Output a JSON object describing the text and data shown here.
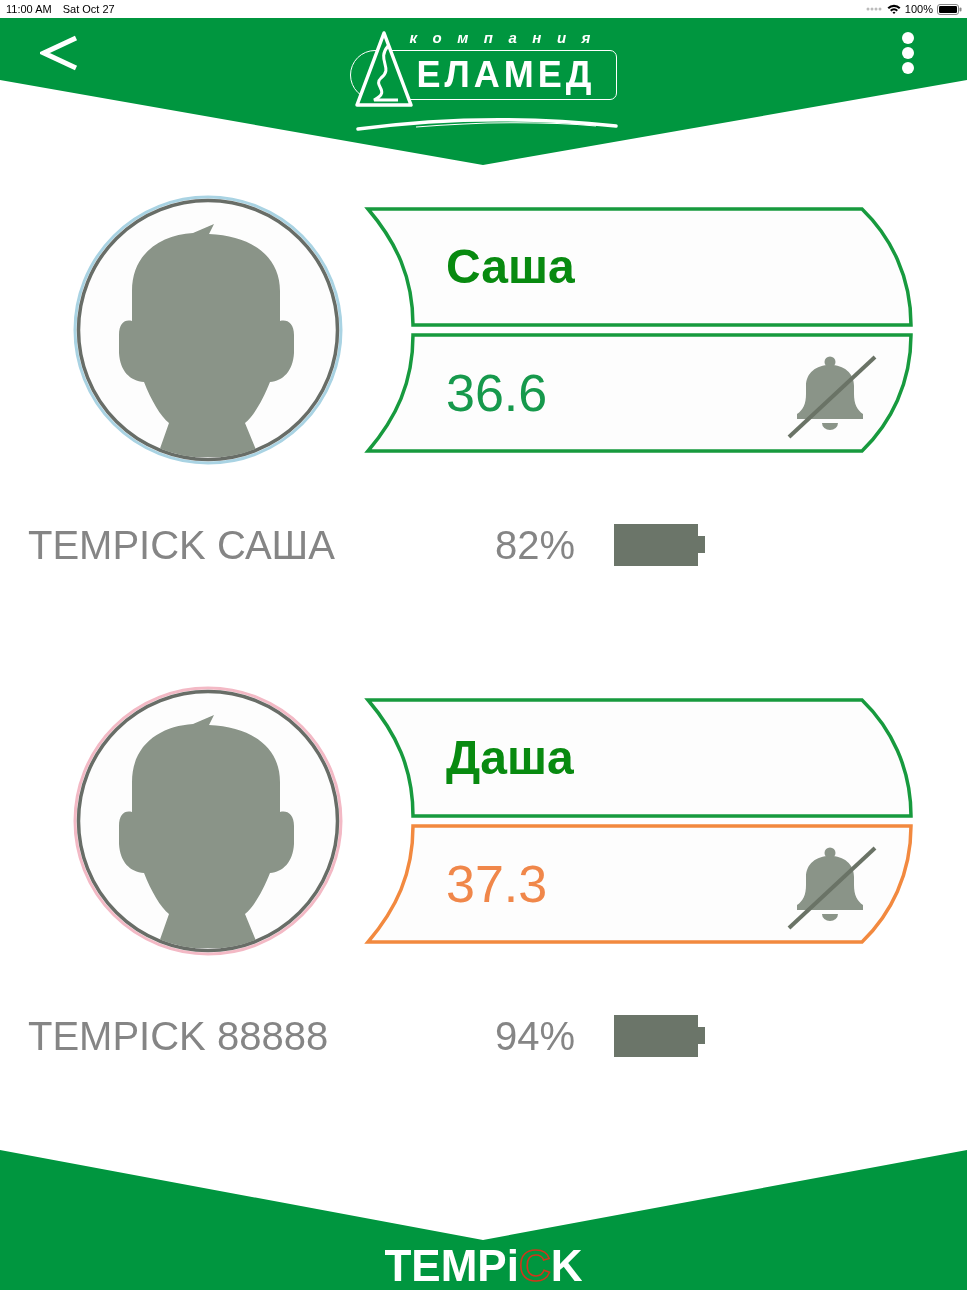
{
  "status_bar": {
    "time": "11:00 AM",
    "date": "Sat Oct 27",
    "battery": "100%"
  },
  "header": {
    "logo": {
      "tagline": "компания",
      "name": "ЕЛАМЕД"
    }
  },
  "devices": [
    {
      "color": "#a9d3e3",
      "name": "Саша",
      "temperature": "36.6",
      "elevated": false,
      "alarm_muted": true,
      "device": "TEMPICK САША",
      "battery": "82%"
    },
    {
      "color": "#f3b9c5",
      "name": "Даша",
      "temperature": "37.3",
      "elevated": true,
      "alarm_muted": true,
      "device": "TEMPICK 88888",
      "battery": "94%"
    }
  ],
  "footer": {
    "logo": {
      "before": "TEMPi",
      "accent": "C",
      "after": "K"
    }
  }
}
